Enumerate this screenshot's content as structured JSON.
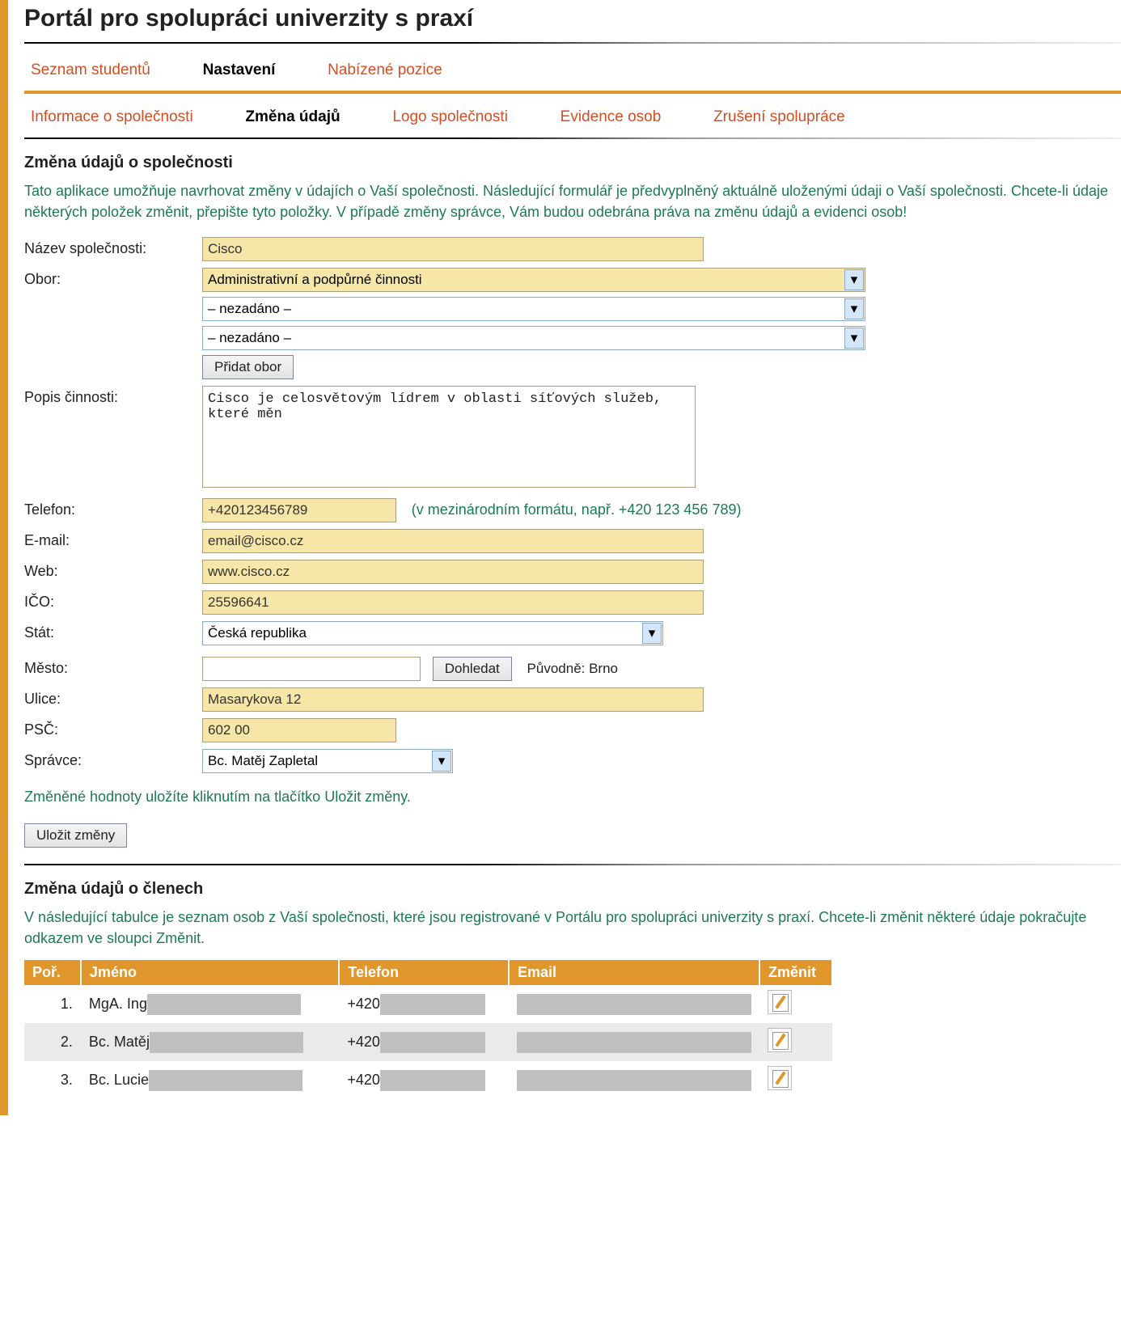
{
  "page_title": "Portál pro spolupráci univerzity s praxí",
  "nav1": [
    {
      "label": "Seznam studentů",
      "active": false
    },
    {
      "label": "Nastavení",
      "active": true
    },
    {
      "label": "Nabízené pozice",
      "active": false
    }
  ],
  "nav2": [
    {
      "label": "Informace o společnosti",
      "active": false
    },
    {
      "label": "Změna údajů",
      "active": true
    },
    {
      "label": "Logo společnosti",
      "active": false
    },
    {
      "label": "Evidence osob",
      "active": false
    },
    {
      "label": "Zrušení spolupráce",
      "active": false
    }
  ],
  "section1_heading": "Změna údajů o společnosti",
  "intro1": "Tato aplikace umožňuje navrhovat změny v údajích o Vaší společnosti. Následující formulář je předvyplněný aktuálně uloženými údaji o Vaší společnosti. Chcete-li údaje některých položek změnit, přepište tyto položky. V případě změny správce, Vám budou odebrána práva na změnu údajů a evidenci osob!",
  "labels": {
    "company": "Název společnosti:",
    "field": "Obor:",
    "desc": "Popis činnosti:",
    "phone": "Telefon:",
    "email": "E-mail:",
    "web": "Web:",
    "ico": "IČO:",
    "country": "Stát:",
    "city": "Město:",
    "street": "Ulice:",
    "psc": "PSČ:",
    "admin": "Správce:"
  },
  "form": {
    "company": "Cisco",
    "obor1": "Administrativní a podpůrné činnosti",
    "obor2": "– nezadáno –",
    "obor3": "– nezadáno –",
    "add_obor_btn": "Přidat obor",
    "desc": "Cisco je celosvětovým lídrem v oblasti síťových služeb, které měn",
    "phone": "+420123456789",
    "phone_hint": "(v mezinárodním formátu, např. +420 123 456 789)",
    "email": "email@cisco.cz",
    "web": "www.cisco.cz",
    "ico": "25596641",
    "country": "Česká republika",
    "city": "",
    "city_btn": "Dohledat",
    "city_after": "Původně: Brno",
    "street": "Masarykova 12",
    "psc": "602 00",
    "admin": "Bc. Matěj Zapletal"
  },
  "save_hint": "Změněné hodnoty uložíte kliknutím na tlačítko Uložit změny.",
  "save_btn": "Uložit změny",
  "section2_heading": "Změna údajů o členech",
  "intro2": "V následující tabulce je seznam osob z Vaší společnosti, které jsou registrované v Portálu pro spolupráci univerzity s praxí. Chcete-li změnit některé údaje pokračujte odkazem ve sloupci Změnit.",
  "table": {
    "headers": {
      "por": "Poř.",
      "jmeno": "Jméno",
      "telefon": "Telefon",
      "email": "Email",
      "zmenit": "Změnit"
    },
    "rows": [
      {
        "por": "1.",
        "jmeno": "MgA. Ing",
        "telefon": "+420"
      },
      {
        "por": "2.",
        "jmeno": "Bc. Matěj",
        "telefon": "+420"
      },
      {
        "por": "3.",
        "jmeno": "Bc. Lucie",
        "telefon": "+420"
      }
    ]
  }
}
